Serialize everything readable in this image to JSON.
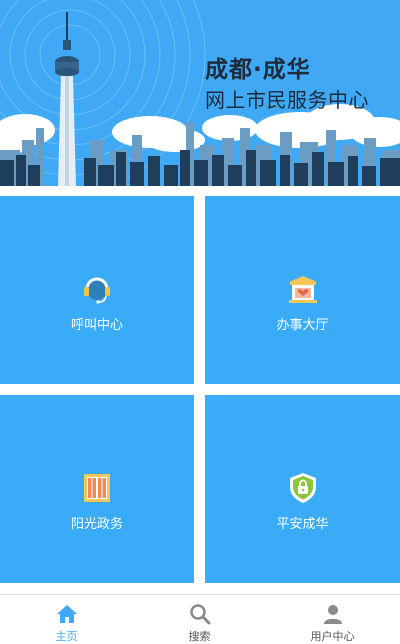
{
  "banner": {
    "title_main": "成都·成华",
    "title_sub": "网上市民服务中心"
  },
  "tiles": [
    {
      "label": "呼叫中心",
      "icon": "headset-agent-icon"
    },
    {
      "label": "办事大厅",
      "icon": "hall-building-icon"
    },
    {
      "label": "阳光政务",
      "icon": "window-doors-icon"
    },
    {
      "label": "平安成华",
      "icon": "shield-lock-icon"
    }
  ],
  "tabbar": {
    "items": [
      {
        "label": "主页",
        "icon": "home-icon",
        "active": true
      },
      {
        "label": "搜索",
        "icon": "search-icon",
        "active": false
      },
      {
        "label": "用户中心",
        "icon": "user-icon",
        "active": false
      }
    ]
  },
  "colors": {
    "banner_bg": "#3fa9f5",
    "tile_bg": "#3aabf7",
    "active_tab": "#3fa9f5"
  }
}
